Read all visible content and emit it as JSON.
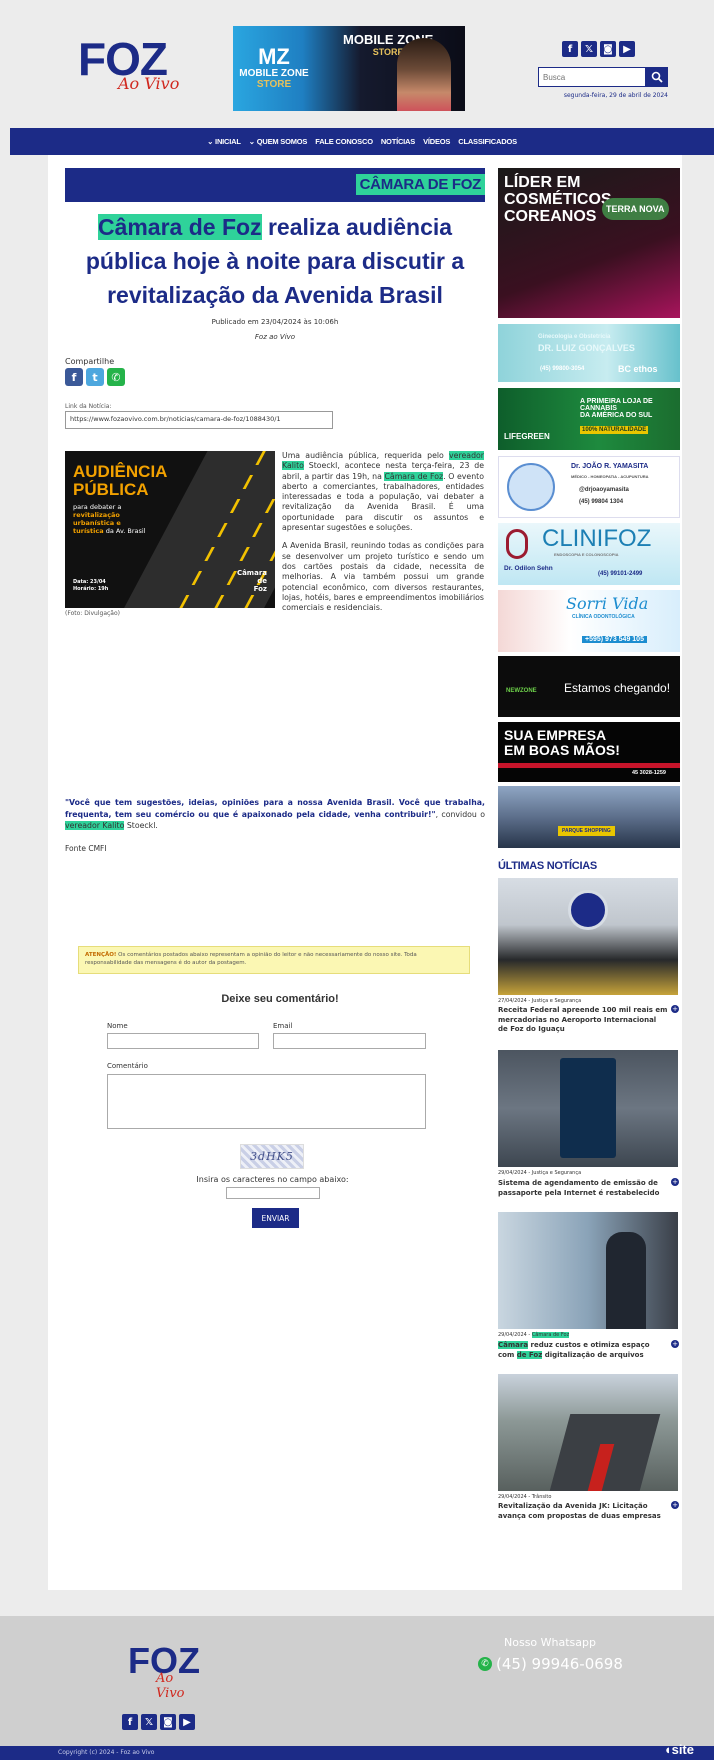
{
  "brand": {
    "logo_main": "FOZ",
    "logo_sub": "Ao Vivo",
    "color_primary": "#1c2b87",
    "color_accent": "#2fd29a",
    "color_logo_red": "#d0281f"
  },
  "header": {
    "banner": {
      "logo_big": "MZ",
      "logo_small": "MOBILE ZONE",
      "logo_store": "STORE",
      "title": "MOBILE ZONE",
      "title_sub": "STORE"
    },
    "socials": [
      "facebook-icon",
      "x-icon",
      "instagram-icon",
      "youtube-icon"
    ],
    "search_placeholder": "Busca",
    "date": "segunda-feira, 29 de abril de 2024"
  },
  "nav": {
    "items": [
      "⌄ INICIAL",
      "⌄ QUEM SOMOS",
      "FALE CONOSCO",
      "NOTÍCIAS",
      "VÍDEOS",
      "CLASSIFICADOS"
    ]
  },
  "article": {
    "category": "CÂMARA DE FOZ",
    "title_highlight": "Câmara de Foz",
    "title_rest": " realiza audiência pública hoje à noite para discutir a revitalização da Avenida Brasil",
    "published": "Publicado em 23/04/2024 às 10:06h",
    "author": "Foz ao Vivo",
    "share_label": "Compartilhe",
    "link_label": "Link da Notícia:",
    "link_value": "https://www.fozaovivo.com.br/noticias/camara-de-foz/1088430/1",
    "image": {
      "headline1": "AUDIÊNCIA",
      "headline2": "PÚBLICA",
      "line1": "para debater a",
      "line1_hl": "revitalização",
      "line2_hl": "urbanística e turística",
      "line3": "da Av. Brasil",
      "date1": "Data: 23/04",
      "date2": "Horário: 19h",
      "org1": "Câmara",
      "org2": "de",
      "org3": "Foz"
    },
    "caption": "(Foto: Divulgação)",
    "p1_a": "Uma audiência pública, requerida pelo ",
    "p1_hl1": "vereador Kalito",
    "p1_b": " Stoeckl, acontece nesta terça-feira, 23 de abril, a partir das 19h, na ",
    "p1_hl2": "Câmara de Foz",
    "p1_c": ". O evento aberto a comerciantes, trabalhadores, entidades interessadas e toda a população, vai debater a revitalização da Avenida Brasil. É uma oportunidade para discutir os assuntos e apresentar sugestões e soluções.",
    "p2": "A Avenida Brasil, reunindo todas as condições para se desenvolver um projeto turístico e sendo um dos cartões postais da cidade, necessita de melhorias. A via também possui um grande potencial econômico, com diversos restaurantes, lojas, hotéis, bares e empreendimentos imobiliários comerciais e residenciais.",
    "quote_a": "\"Você que tem sugestões, ideias, opiniões para a nossa Avenida Brasil. Você que trabalha, frequenta, tem seu comércio ou que é apaixonado pela cidade, venha contribuir!\"",
    "quote_b": ", convidou o ",
    "quote_hl": "vereador Kalito",
    "quote_c": " Stoeckl.",
    "source": "Fonte CMFI"
  },
  "comments": {
    "warning_bold": "ATENÇÃO!",
    "warning_text": " Os comentários postados abaixo representam a opinião do leitor e não necessariamente do nosso site. Toda responsabilidade das mensagens é do autor da postagem.",
    "title": "Deixe seu comentário!",
    "name_label": "Nome",
    "email_label": "Email",
    "comment_label": "Comentário",
    "captcha_text": "3dHK5",
    "captcha_label": "Insira os caracteres no campo abaixo:",
    "send_label": "ENVIAR"
  },
  "sidebar": {
    "ads": {
      "ad1_line1": "LÍDER EM",
      "ad1_line2": "COSMÉTICOS",
      "ad1_line3": "COREANOS",
      "ad1_brand": "TERRA NOVA",
      "ad2_line1": "Ginecologia e Obstetrícia",
      "ad2_line2": "DR. LUIZ GONÇALVES",
      "ad2_line3": "(45) 99800-3054",
      "ad2_brand": "BC ethos",
      "ad3_line1": "A PRIMEIRA LOJA DE CANNABIS",
      "ad3_line2": "DA AMÉRICA DO SUL",
      "ad3_line3": "100% NATURALIDADE",
      "ad3_brand": "LIFEGREEN",
      "ad4_name": "Dr. JOÃO R. YAMASITA",
      "ad4_sub": "MÉDICO - HOMEOPATIA - ACUPUNTURA",
      "ad4_insta": "@drjoaoyamasita",
      "ad4_phone": "(45) 99804 1304",
      "ad5_name": "CLINIFOZ",
      "ad5_sub": "ENDOSCOPIA E COLONOSCOPIA",
      "ad5_doctor": "Dr. Odilon Sehn",
      "ad5_phone": "(45) 99101-2499",
      "ad6_name": "Sorri Vida",
      "ad6_sub": "CLÍNICA ODONTOLÓGICA",
      "ad6_phone": "+595) 973 549 105",
      "ad7_brand": "NEWZONE",
      "ad7_text": "Estamos chegando!",
      "ad8_line1": "SUA EMPRESA",
      "ad8_line2": "EM BOAS MÃOS!",
      "ad8_phone": "45 3028-1259",
      "ad9_text": "PARQUE SHOPPING"
    },
    "latest_title": "ÚLTIMAS NOTÍCIAS",
    "news": [
      {
        "meta": "27/04/2024 - Justiça e Segurança",
        "title": "Receita Federal apreende 100 mil reais em mercadorias no Aeroporto Internacional de Foz do Iguaçu"
      },
      {
        "meta": "29/04/2024 - Justiça e Segurança",
        "title": "Sistema de agendamento de emissão de passaporte pela Internet é restabelecido"
      },
      {
        "meta": "29/04/2024 -",
        "meta_hl": "Câmara de Foz",
        "title_hl1": "Câmara",
        "title_a": " reduz custos e otimiza espaço com ",
        "title_hl2": "de Foz",
        "title_b": " digitalização de arquivos"
      },
      {
        "meta": "29/04/2024 - Trânsito",
        "title": "Revitalização da Avenida JK: Licitação avança com propostas de duas empresas"
      }
    ]
  },
  "footer": {
    "whats_title": "Nosso Whatsapp",
    "whats_number": "(45) 99946-0698",
    "copyright": "Copyright (c) 2024 - Foz ao Vivo",
    "site_label": "site"
  }
}
